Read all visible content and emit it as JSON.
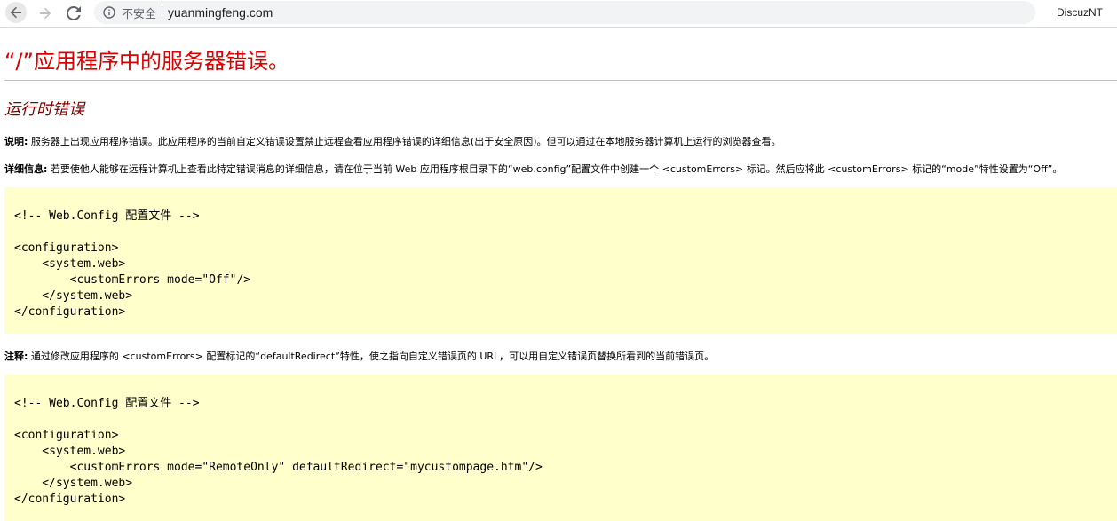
{
  "browser": {
    "insecure_label": "不安全",
    "url": "yuanmingfeng.com",
    "extension_label": "DiscuzNT",
    "icons": {
      "back": "arrow-left-icon",
      "forward": "arrow-right-icon",
      "reload": "reload-icon",
      "info": "info-circle-icon"
    }
  },
  "page": {
    "title": "“/”应用程序中的服务器错误。",
    "subtitle": "运行时错误",
    "description": {
      "label": "说明:",
      "text": " 服务器上出现应用程序错误。此应用程序的当前自定义错误设置禁止远程查看应用程序错误的详细信息(出于安全原因)。但可以通过在本地服务器计算机上运行的浏览器查看。"
    },
    "details": {
      "label": "详细信息:",
      "text": " 若要使他人能够在远程计算机上查看此特定错误消息的详细信息，请在位于当前 Web 应用程序根目录下的“web.config”配置文件中创建一个 <customErrors> 标记。然后应将此 <customErrors> 标记的“mode”特性设置为“Off”。"
    },
    "code_block_1": [
      "<!-- Web.Config 配置文件 -->",
      "",
      "<configuration>",
      "    <system.web>",
      "        <customErrors mode=\"Off\"/>",
      "    </system.web>",
      "</configuration>"
    ],
    "note": {
      "label": "注释:",
      "text": " 通过修改应用程序的 <customErrors> 配置标记的“defaultRedirect”特性，使之指向自定义错误页的 URL，可以用自定义错误页替换所看到的当前错误页。"
    },
    "code_block_2": [
      "<!-- Web.Config 配置文件 -->",
      "",
      "<configuration>",
      "    <system.web>",
      "        <customErrors mode=\"RemoteOnly\" defaultRedirect=\"mycustompage.htm\"/>",
      "    </system.web>",
      "</configuration>"
    ],
    "colors": {
      "title": "#dd0000",
      "subtitle": "#800000",
      "code_background": "#ffffcc"
    }
  }
}
